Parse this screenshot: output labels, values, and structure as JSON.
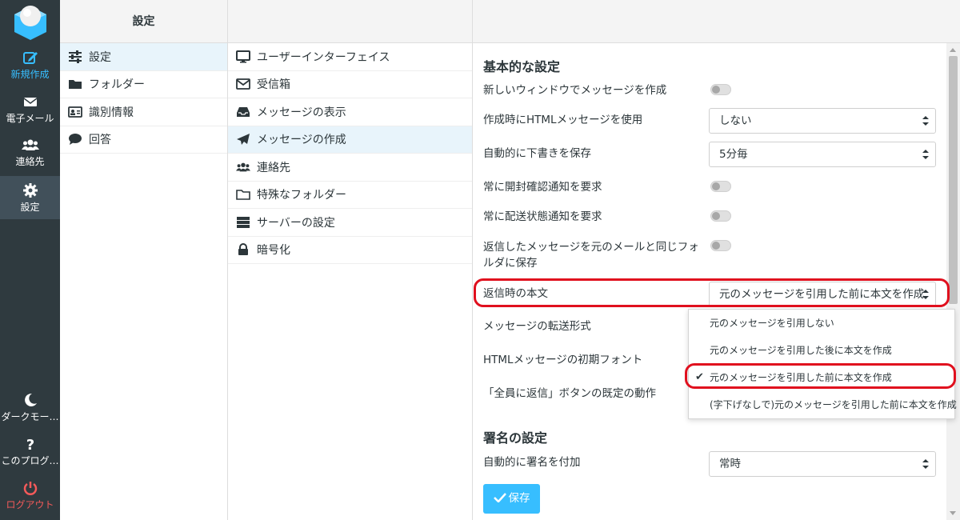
{
  "nav": {
    "compose": "新規作成",
    "mail": "電子メール",
    "contacts": "連絡先",
    "settings": "設定",
    "darkmode": "ダークモー…",
    "about": "このプログ…",
    "logout": "ログアウト"
  },
  "col1": {
    "title": "設定",
    "items": [
      {
        "label": "設定",
        "icon": "sliders-icon"
      },
      {
        "label": "フォルダー",
        "icon": "folder-icon"
      },
      {
        "label": "識別情報",
        "icon": "id-card-icon"
      },
      {
        "label": "回答",
        "icon": "comment-icon"
      }
    ]
  },
  "col2": {
    "items": [
      {
        "label": "ユーザーインターフェイス",
        "icon": "monitor-icon"
      },
      {
        "label": "受信箱",
        "icon": "envelope-icon"
      },
      {
        "label": "メッセージの表示",
        "icon": "inbox-icon"
      },
      {
        "label": "メッセージの作成",
        "icon": "paper-plane-icon"
      },
      {
        "label": "連絡先",
        "icon": "users-icon"
      },
      {
        "label": "特殊なフォルダー",
        "icon": "folder-outline-icon"
      },
      {
        "label": "サーバーの設定",
        "icon": "server-icon"
      },
      {
        "label": "暗号化",
        "icon": "lock-icon"
      }
    ]
  },
  "content": {
    "basic_title": "基本的な設定",
    "new_window": "新しいウィンドウでメッセージを作成",
    "html_compose": "作成時にHTMLメッセージを使用",
    "html_compose_value": "しない",
    "autosave": "自動的に下書きを保存",
    "autosave_value": "5分毎",
    "read_receipt": "常に開封確認通知を要求",
    "dsn": "常に配送状態通知を要求",
    "reply_same_folder_1": "返信したメッセージを元のメールと同じフォ",
    "reply_same_folder_2": "ルダに保存",
    "reply_mode": "返信時の本文",
    "reply_mode_value": "元のメッセージを引用した前に本文を作成",
    "forward_type": "メッセージの転送形式",
    "html_font": "HTMLメッセージの初期フォント",
    "reply_all": "「全員に返信」ボタンの既定の動作",
    "sig_title": "署名の設定",
    "auto_sig": "自動的に署名を付加",
    "auto_sig_value": "常時",
    "save": "保存"
  },
  "dropdown": {
    "options": [
      "元のメッセージを引用しない",
      "元のメッセージを引用した後に本文を作成",
      "元のメッセージを引用した前に本文を作成",
      "(字下げなしで)元のメッセージを引用した前に本文を作成"
    ],
    "selected_index": 2
  },
  "colors": {
    "nav_bg": "#2f3a3f",
    "accent": "#37beff",
    "highlight": "#e0101e",
    "logout": "#f45a5a"
  }
}
